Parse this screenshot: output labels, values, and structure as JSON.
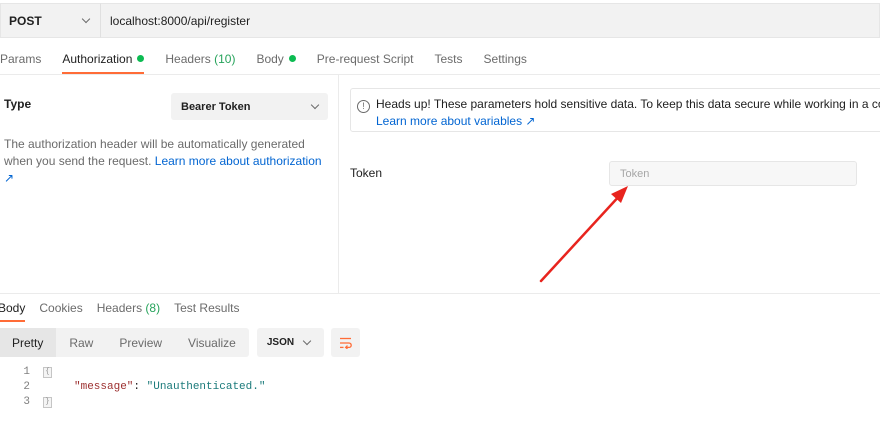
{
  "request": {
    "method": "POST",
    "url": "localhost:8000/api/register"
  },
  "request_tabs": [
    {
      "label": "Params"
    },
    {
      "label": "Authorization",
      "dot": true
    },
    {
      "label": "Headers",
      "count": "(10)"
    },
    {
      "label": "Body",
      "dot": true
    },
    {
      "label": "Pre-request Script"
    },
    {
      "label": "Tests"
    },
    {
      "label": "Settings"
    }
  ],
  "auth": {
    "type_label": "Type",
    "type_value": "Bearer Token",
    "description": "The authorization header will be automatically generated when you send the request.",
    "learn_more": "Learn more about authorization ↗",
    "notice_line1": "Heads up! These parameters hold sensitive data. To keep this data secure while working in a collabor",
    "notice_link": "Learn more about variables ↗",
    "token_label": "Token",
    "token_placeholder": "Token",
    "token_value": ""
  },
  "response_tabs": [
    {
      "label": "Body"
    },
    {
      "label": "Cookies"
    },
    {
      "label": "Headers",
      "count": "(8)"
    },
    {
      "label": "Test Results"
    }
  ],
  "format": {
    "modes": [
      "Pretty",
      "Raw",
      "Preview",
      "Visualize"
    ],
    "language": "JSON"
  },
  "code": {
    "line_numbers": [
      "1",
      "2",
      "3"
    ],
    "key": "\"message\"",
    "colon": ": ",
    "value": "\"Unauthenticated.\""
  },
  "colors": {
    "accent": "#ff6c37",
    "dot_green": "#0cbb52",
    "link_blue": "#0265d2",
    "annotation_arrow": "#e8241e"
  },
  "icons": [
    "chevron-down-icon",
    "info-icon",
    "external-link-icon",
    "wrap-lines-icon",
    "fold-icon"
  ]
}
